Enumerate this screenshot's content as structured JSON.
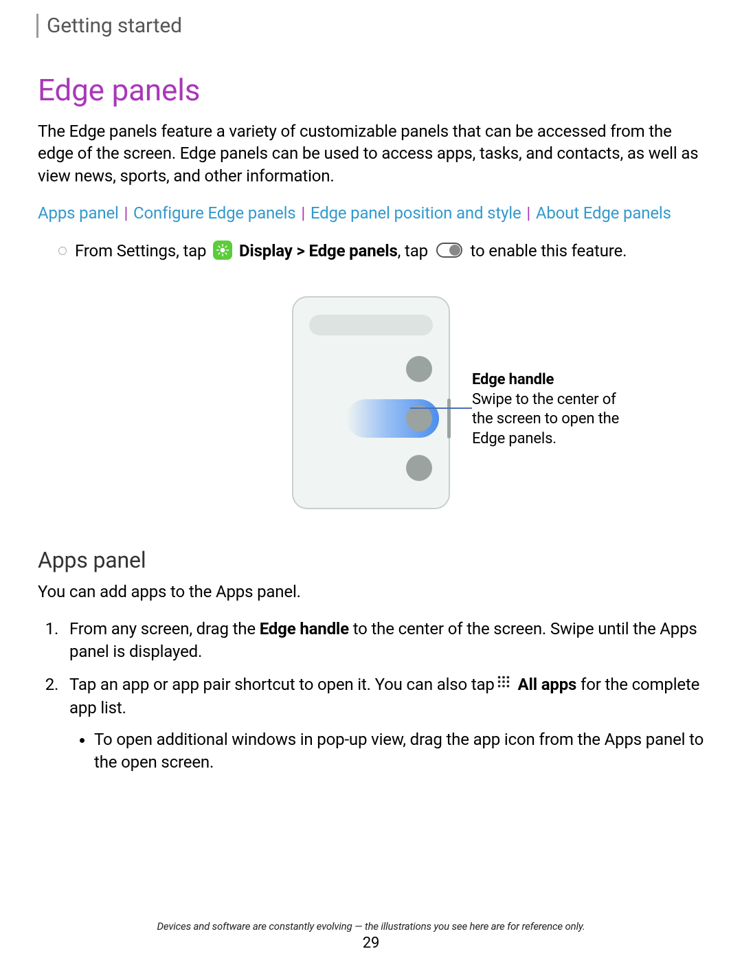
{
  "breadcrumb": "Getting started",
  "title": "Edge panels",
  "intro": "The Edge panels feature a variety of customizable panels that can be accessed from the edge of the screen. Edge panels can be used to access apps, tasks, and contacts, as well as view news, sports, and other information.",
  "nav": {
    "l1": "Apps panel",
    "l2": "Configure Edge panels",
    "l3": "Edge panel position and style",
    "l4": "About Edge panels",
    "sep": "|"
  },
  "instruction": {
    "pre": "From Settings, tap ",
    "bold1": " Display > Edge panels",
    "mid": ", tap ",
    "post": " to enable this feature."
  },
  "callout": {
    "title": "Edge handle",
    "body": "Swipe to the center of the screen to open the Edge panels."
  },
  "section2": {
    "title": "Apps panel",
    "intro": "You can add apps to the Apps panel.",
    "step1_pre": "From any screen, drag the ",
    "step1_bold": "Edge handle",
    "step1_post": " to the center of the screen. Swipe until the Apps panel is displayed.",
    "step2_pre": "Tap an app or app pair shortcut to open it. You can also tap",
    "step2_bold": " All apps",
    "step2_post": " for the complete app list.",
    "sub1": "To open additional windows in pop-up view, drag the app icon from the Apps panel to the open screen."
  },
  "footer": "Devices and software are constantly evolving — the illustrations you see here are for reference only.",
  "page": "29"
}
